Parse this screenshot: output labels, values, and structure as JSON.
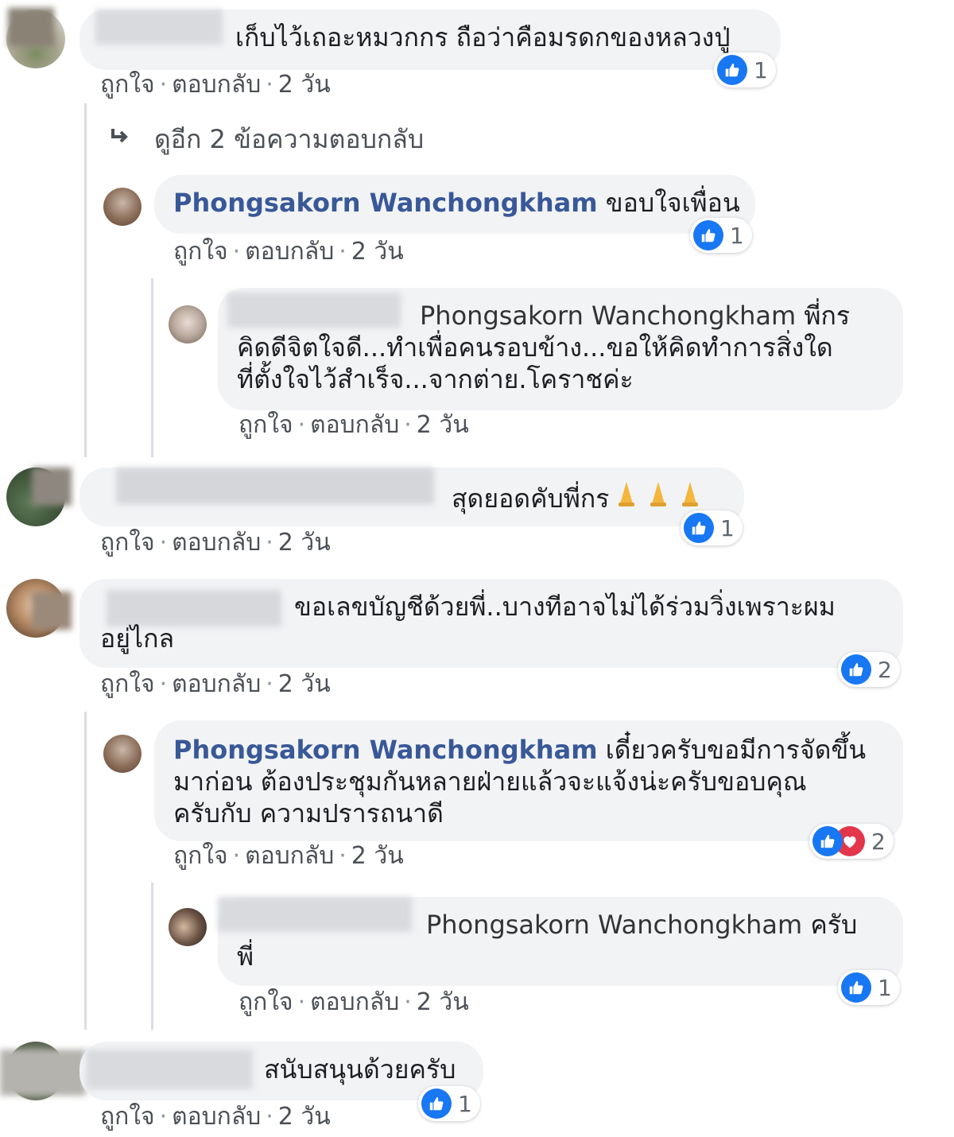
{
  "actions": {
    "like": "ถูกใจ",
    "reply": "ตอบกลับ",
    "sep": "·"
  },
  "colors": {
    "like_blue": "#1877f2",
    "love_red": "#e4364b",
    "bubble": "#f2f3f5",
    "author": "#385898"
  },
  "comments": [
    {
      "text": "เก็บไว้เถอะหมวกกร ถือว่าคือมรดกของหลวงปู่",
      "time": "2 วัน",
      "reactions": "1"
    },
    {
      "more_replies": "ดูอีก 2 ข้อความตอบกลับ"
    },
    {
      "author": "Phongsakorn Wanchongkham",
      "text": " ขอบใจเพื่อน",
      "time": "2 วัน",
      "reactions": "1"
    },
    {
      "mention": "Phongsakorn Wanchongkham",
      "text_line1": " พี่กร",
      "text_line2": "คิดดีจิตใจดี...ทำเพื่อคนรอบข้าง...ขอให้คิดทำการสิ่งใด",
      "text_line3": "ที่ตั้งใจไว้สำเร็จ...จากต่าย.โคราชค่ะ",
      "time": "2 วัน"
    },
    {
      "text": "สุดยอดคับพี่กร",
      "time": "2 วัน",
      "reactions": "1"
    },
    {
      "text_line1": "ขอเลขบัญชีด้วยพี่..บางทีอาจไม่ได้ร่วมวิ่งเพราะผม",
      "text_line2": "อยู่ไกล",
      "time": "2 วัน",
      "reactions": "2"
    },
    {
      "author": "Phongsakorn Wanchongkham",
      "text_line1": " เดี๋ยวครับขอมีการจัดขึ้น",
      "text_line2": "มาก่อน ต้องประชุมกันหลายฝ่ายแล้วจะแจ้งน่ะครับขอบคุณ",
      "text_line3": "ครับกับ ความปรารถนาดี",
      "time": "2 วัน",
      "reactions": "2"
    },
    {
      "mention": "Phongsakorn Wanchongkham",
      "text_line1": " ครับ",
      "text_line2": "พี่",
      "time": "2 วัน",
      "reactions": "1"
    },
    {
      "text": "สนับสนุนด้วยครับ",
      "time": "2 วัน",
      "reactions": "1"
    }
  ]
}
